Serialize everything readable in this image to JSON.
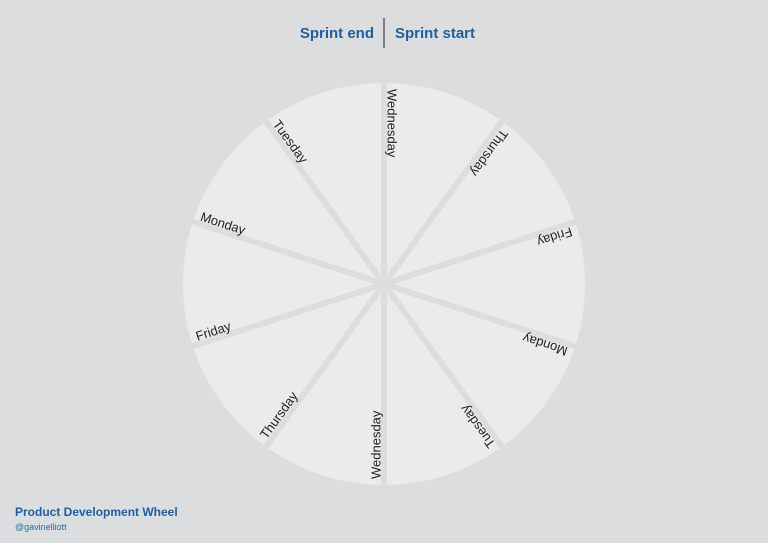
{
  "header": {
    "left_label": "Sprint end",
    "right_label": "Sprint start"
  },
  "wheel": {
    "segments": [
      {
        "day": "Wednesday"
      },
      {
        "day": "Thursday"
      },
      {
        "day": "Friday"
      },
      {
        "day": "Monday"
      },
      {
        "day": "Tuesday"
      },
      {
        "day": "Wednesday"
      },
      {
        "day": "Thursday"
      },
      {
        "day": "Friday"
      },
      {
        "day": "Monday"
      },
      {
        "day": "Tuesday"
      }
    ],
    "colors": {
      "segment_fill": "#ebebeb",
      "divider": "#dcdddf",
      "label_text": "#222222"
    }
  },
  "footer": {
    "title": "Product Development Wheel",
    "handle": "@gavinelliott"
  },
  "colors": {
    "background": "#dcdddf",
    "accent": "#1f5f9e"
  }
}
